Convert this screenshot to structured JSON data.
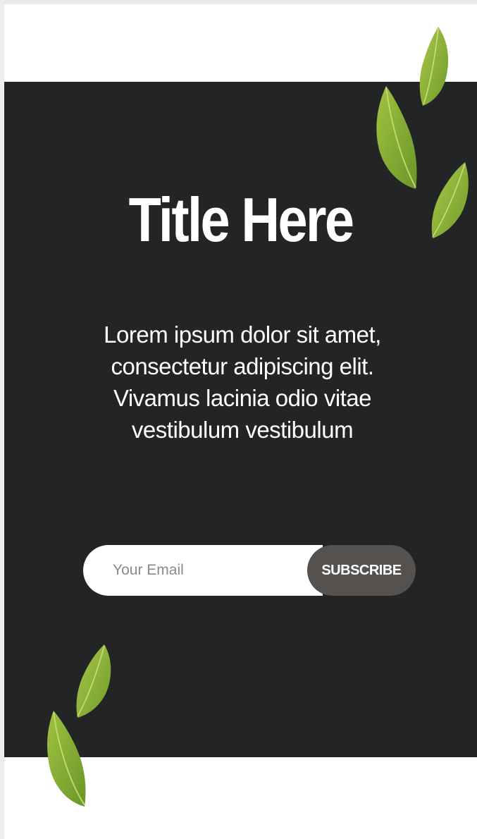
{
  "hero": {
    "title": "Title Here",
    "description": "Lorem ipsum dolor sit amet, consectetur adipiscing elit. Vivamus lacinia odio vitae vestibulum vestibulum"
  },
  "subscribe_form": {
    "email_placeholder": "Your Email",
    "button_label": "SUBSCRIBE"
  },
  "colors": {
    "section_background": "#222426",
    "button_background": "#54514f",
    "leaf_green": "#8db33a"
  },
  "decorations": [
    "basil-leaf",
    "basil-leaf",
    "basil-leaf",
    "basil-leaf",
    "basil-leaf"
  ]
}
